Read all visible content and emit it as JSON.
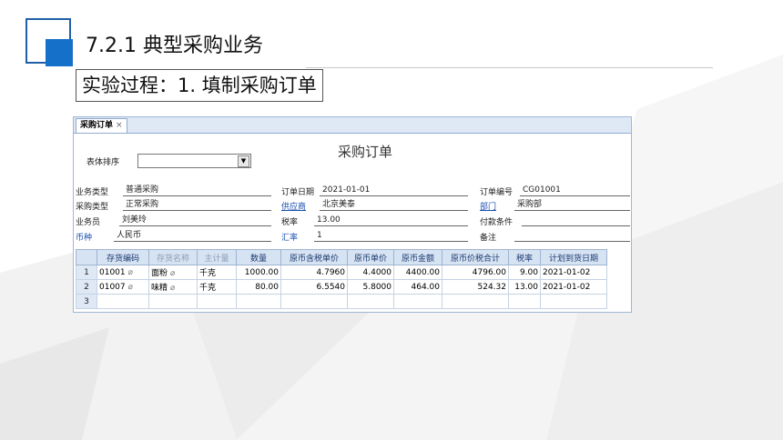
{
  "slide": {
    "title": "7.2.1  典型采购业务",
    "subtitle": "实验过程：1. 填制采购订单"
  },
  "window": {
    "tab_label": "采购订单",
    "tab_close": "×",
    "form_title": "采购订单",
    "sort_label": "表体排序",
    "sort_value": "",
    "fields": {
      "business_type_label": "业务类型",
      "business_type_value": "普通采购",
      "purchase_type_label": "采购类型",
      "purchase_type_value": "正常采购",
      "salesperson_label": "业务员",
      "salesperson_value": "刘美玲",
      "currency_label": "币种",
      "currency_value": "人民币",
      "order_date_label": "订单日期",
      "order_date_value": "2021-01-01",
      "supplier_label": "供应商",
      "supplier_value": "北京美泰",
      "tax_rate_label": "税率",
      "tax_rate_value": "13.00",
      "exchange_rate_label": "汇率",
      "exchange_rate_value": "1",
      "order_no_label": "订单编号",
      "order_no_value": "CG01001",
      "department_label": "部门",
      "department_value": "采购部",
      "payment_terms_label": "付款条件",
      "payment_terms_value": "",
      "remarks_label": "备注",
      "remarks_value": ""
    },
    "table": {
      "headers": [
        "",
        "存货编码",
        "存货名称",
        "主计量",
        "数量",
        "原币含税单价",
        "原币单价",
        "原币金额",
        "原币价税合计",
        "税率",
        "计划到货日期"
      ],
      "rows": [
        [
          "1",
          "01001",
          "面粉",
          "千克",
          "1000.00",
          "4.7960",
          "4.4000",
          "4400.00",
          "4796.00",
          "9.00",
          "2021-01-02"
        ],
        [
          "2",
          "01007",
          "味精",
          "千克",
          "80.00",
          "6.5540",
          "5.8000",
          "464.00",
          "524.32",
          "13.00",
          "2021-01-02"
        ],
        [
          "3",
          "",
          "",
          "",
          "",
          "",
          "",
          "",
          "",
          "",
          ""
        ]
      ]
    }
  },
  "colors": {
    "accent": "#1570c9",
    "header_bg": "#d6e3f3",
    "label_blue": "#1a4fb0"
  },
  "icons": {
    "attachment": "paperclip-icon",
    "dropdown": "chevron-down-icon"
  }
}
